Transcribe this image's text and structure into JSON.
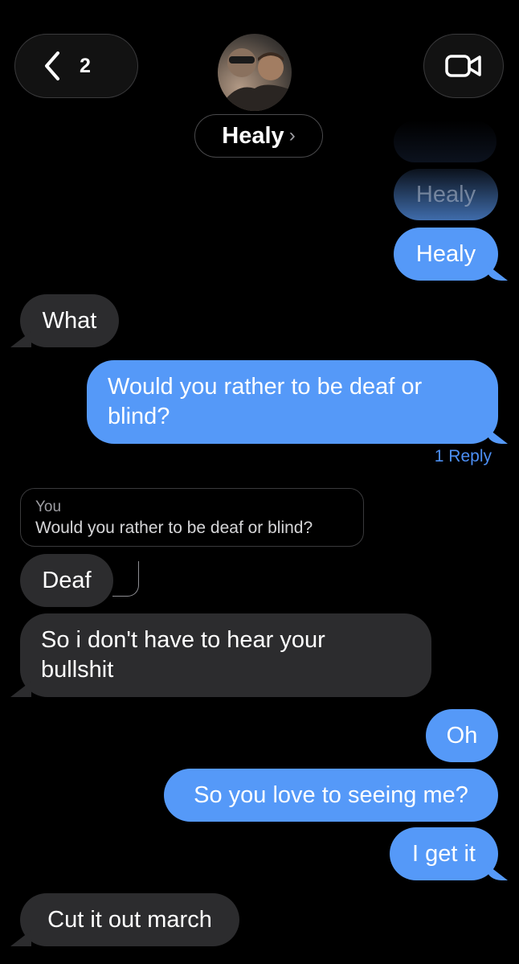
{
  "header": {
    "back_count": "2",
    "contact_name": "Healy",
    "name_chevron": "›"
  },
  "icons": {
    "back": "chevron-left-icon",
    "video": "video-camera-icon",
    "name_chevron": "chevron-right-icon"
  },
  "colors": {
    "sent_bubble": "#5599f8",
    "received_bubble": "#2c2c2e",
    "background": "#000000",
    "reply_link": "#4c8ff5"
  },
  "messages": [
    {
      "text": "Healy",
      "direction": "sent",
      "faded": true
    },
    {
      "text": "Healy",
      "direction": "sent"
    },
    {
      "text": "What",
      "direction": "received"
    },
    {
      "text": "Would you rather to be deaf or blind?",
      "direction": "sent"
    },
    {
      "text": "Deaf",
      "direction": "received"
    },
    {
      "text": "So i don't have to hear your bullshit",
      "direction": "received"
    },
    {
      "text": "Oh",
      "direction": "sent"
    },
    {
      "text": "So you love to seeing me?",
      "direction": "sent"
    },
    {
      "text": "I get it",
      "direction": "sent"
    },
    {
      "text": "Cut it out march",
      "direction": "received"
    }
  ],
  "reply_count_label": "1 Reply",
  "reply_quote": {
    "sender": "You",
    "text": "Would you rather to be deaf or blind?"
  }
}
